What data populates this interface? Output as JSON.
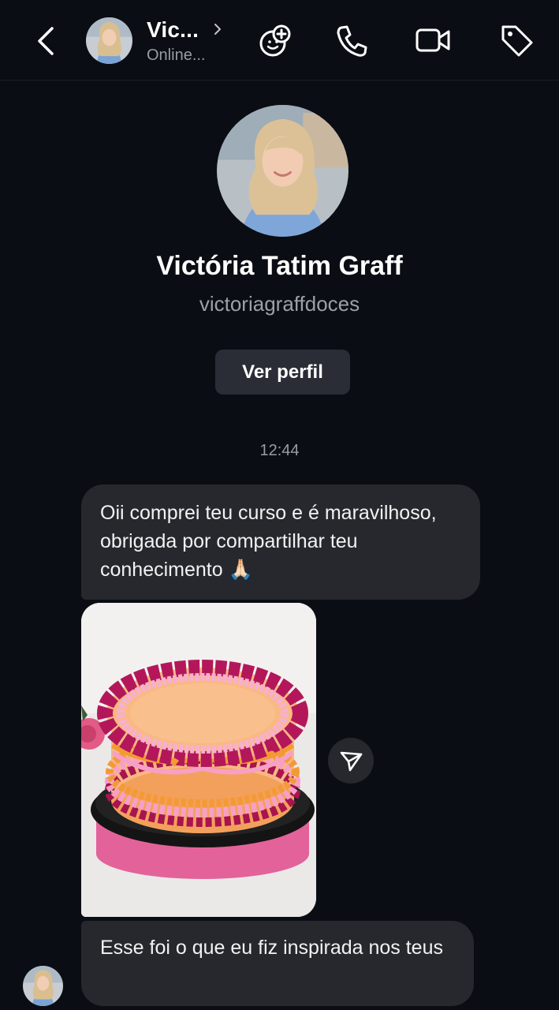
{
  "header": {
    "name": "Vic...",
    "status": "Online...",
    "icons": [
      "back-arrow-icon",
      "add-effect-icon",
      "phone-icon",
      "video-call-icon",
      "tag-icon"
    ]
  },
  "profile": {
    "name": "Victória Tatim Graff",
    "username": "victoriagraffdoces",
    "view_profile_label": "Ver perfil"
  },
  "conversation": {
    "timestamp": "12:44",
    "messages": [
      {
        "type": "text",
        "text": "Oii comprei teu curso e é maravilhoso, obrigada por compartilhar teu conhecimento 🙏🏻"
      },
      {
        "type": "image",
        "alt": "bolo decorado"
      },
      {
        "type": "text",
        "text": "Esse foi o que eu fiz inspirada nos teus"
      }
    ]
  },
  "colors": {
    "background": "#0b0d14",
    "bubble": "#26282e",
    "button": "#2a2d35",
    "muted_text": "#9a9ca3"
  }
}
